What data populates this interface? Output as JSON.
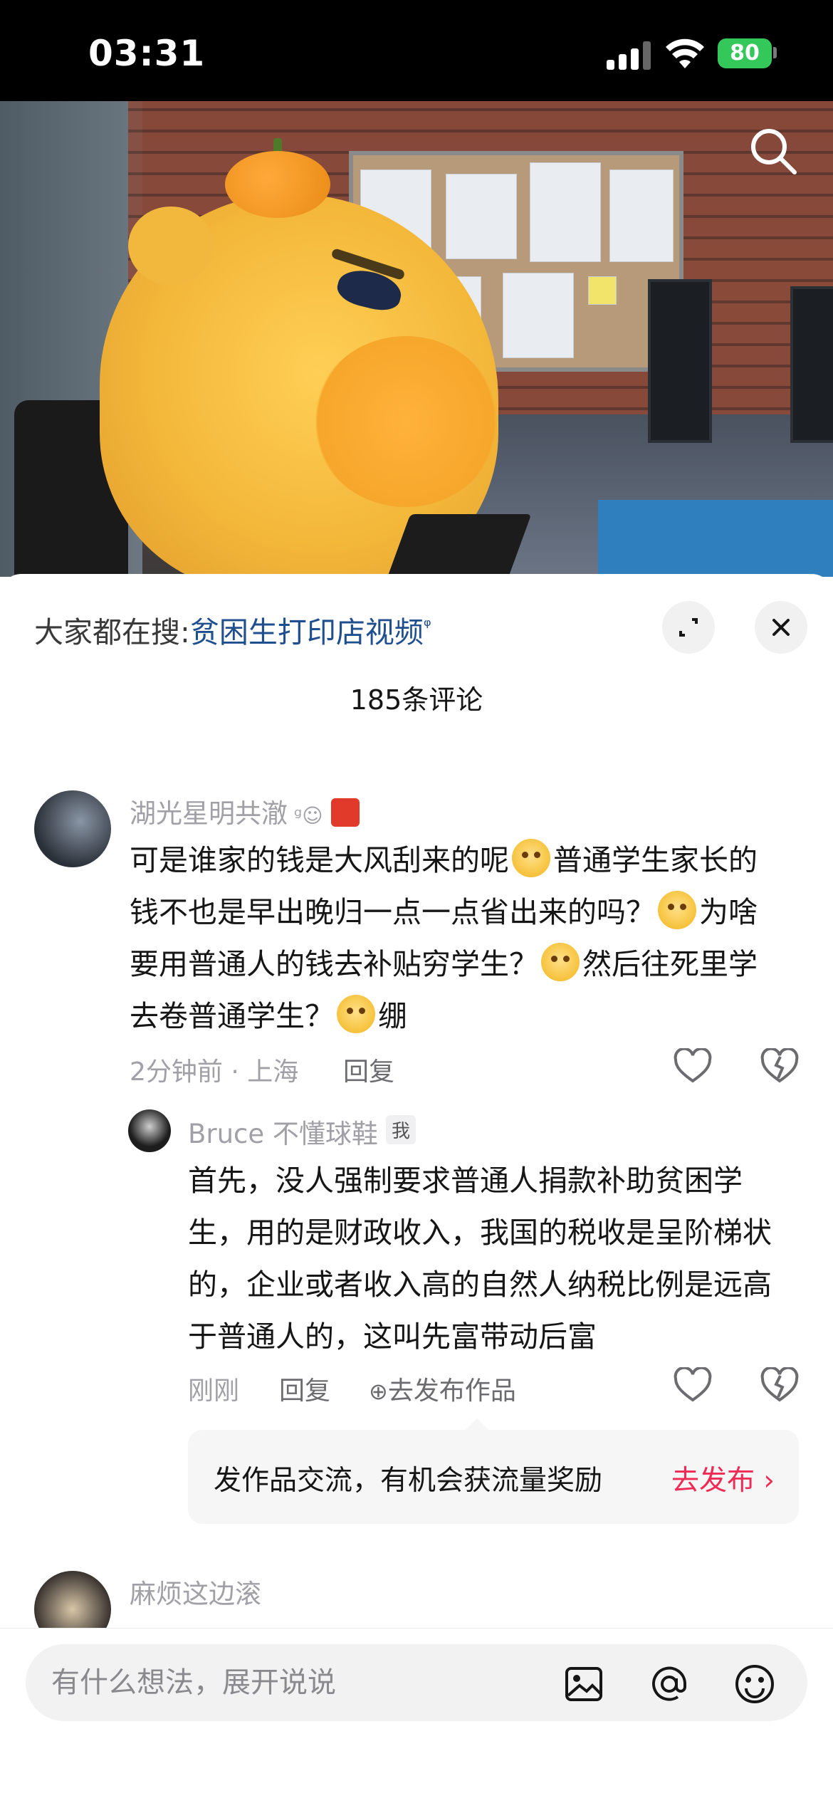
{
  "status_bar": {
    "time": "03:31",
    "battery": "80"
  },
  "video": {
    "search_icon": "search-icon"
  },
  "sheet": {
    "hot_search_prefix": "大家都在搜:",
    "hot_search_link": "贫困生打印店视频",
    "comment_count": "185条评论"
  },
  "comments": [
    {
      "username": "湖光星明共澈",
      "parts": [
        "可是谁家的钱是大风刮来的呢",
        "普通学生家长的钱不也是早出晚归一点一点省出来的吗？",
        "为啥要用普通人的钱去补贴穷学生？",
        "然后往死里学去卷普通学生？",
        "绷"
      ],
      "time_location": "2分钟前 · 上海",
      "reply_label": "回复"
    },
    {
      "username": "Bruce 不懂球鞋",
      "me_tag": "我",
      "text": "首先，没人强制要求普通人捐款补助贫困学生，用的是财政收入，我国的税收是呈阶梯状的，企业或者收入高的自然人纳税比例是远高于普通人的，这叫先富带动后富",
      "time": "刚刚",
      "reply_label": "回复",
      "publish_label": "去发布作品"
    },
    {
      "username": "麻烦这边滚"
    }
  ],
  "promo": {
    "text": "发作品交流，有机会获流量奖励",
    "link": "去发布"
  },
  "input": {
    "placeholder": "有什么想法，展开说说"
  },
  "colors": {
    "accent": "#ee2a55",
    "link": "#1f4f8f",
    "battery": "#34c759"
  }
}
